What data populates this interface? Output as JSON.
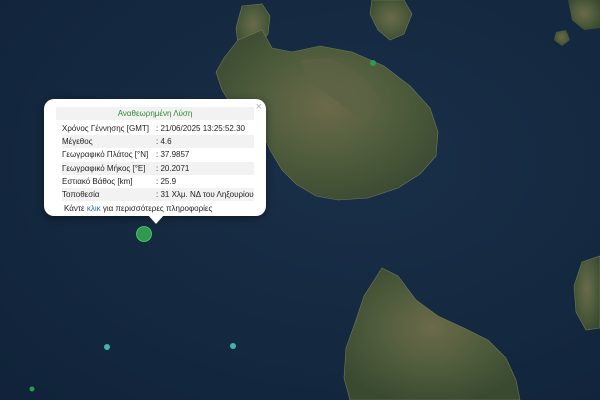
{
  "popup": {
    "title": "Αναθεωρημένη Λύση",
    "close_symbol": "×",
    "rows": [
      {
        "label": "Χρόνος Γέννησης [GMT]",
        "value": ": 21/06/2025 13:25:52.30"
      },
      {
        "label": "Μέγεθος",
        "value": ": 4.6"
      },
      {
        "label": "Γεωγραφικό Πλάτος [°N]",
        "value": ": 37.9857"
      },
      {
        "label": "Γεωγραφικό Μήκος [°E]",
        "value": ": 20.2071"
      },
      {
        "label": "Εστιακό Βάθος [km]",
        "value": ": 25.9"
      },
      {
        "label": "Τοποθεσία",
        "value": ": 31 Χλμ. ΝΔ του Ληξουρίου"
      }
    ],
    "more": {
      "prefix": "Κάντε ",
      "link": "κλικ",
      "suffix": " για περισσότερες πληροφορίες"
    }
  },
  "map": {
    "sea_color": "#14283d",
    "land_color": "#4c5a3b",
    "main_event_color": "#2f9a4e",
    "minor_event_color": "#3fb7a6"
  }
}
